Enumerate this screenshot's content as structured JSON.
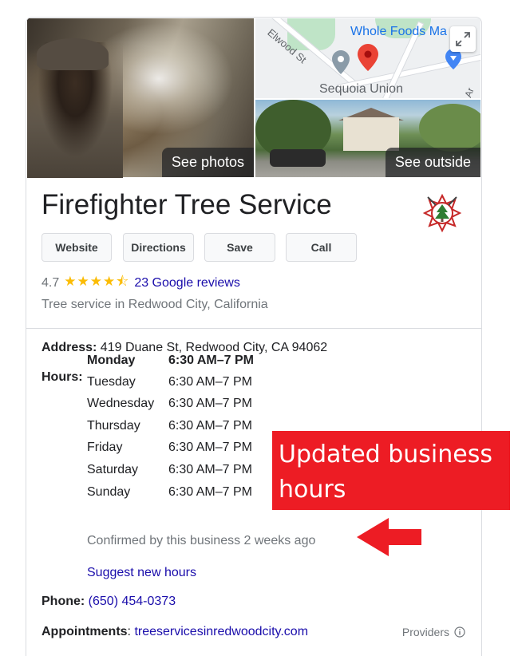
{
  "photos": {
    "main_button": "See photos",
    "outside_button": "See outside"
  },
  "map": {
    "place_label_1": "Whole Foods Ma",
    "place_label_2": "Sequoia Union",
    "street_label": "Elwood St",
    "street_label_2": "Ar"
  },
  "business": {
    "name": "Firefighter Tree Service",
    "category": "Tree service in Redwood City, California",
    "rating": "4.7",
    "stars": "★★★★⯪",
    "reviews_link": "23 Google reviews"
  },
  "actions": {
    "website": "Website",
    "directions": "Directions",
    "save": "Save",
    "call": "Call"
  },
  "address": {
    "label": "Address:",
    "value": " 419 Duane St, Redwood City, CA 94062"
  },
  "hours": {
    "label": "Hours:",
    "days": [
      {
        "day": "Monday",
        "time": "6:30 AM–7 PM"
      },
      {
        "day": "Tuesday",
        "time": "6:30 AM–7 PM"
      },
      {
        "day": "Wednesday",
        "time": "6:30 AM–7 PM"
      },
      {
        "day": "Thursday",
        "time": "6:30 AM–7 PM"
      },
      {
        "day": "Friday",
        "time": "6:30 AM–7 PM"
      },
      {
        "day": "Saturday",
        "time": "6:30 AM–7 PM"
      },
      {
        "day": "Sunday",
        "time": "6:30 AM–7 PM"
      }
    ],
    "confirmed": "Confirmed by this business 2 weeks ago",
    "suggest_link": "Suggest new hours"
  },
  "phone": {
    "label": "Phone:",
    "value": "(650) 454-0373"
  },
  "appointments": {
    "label": "Appointments",
    "separator": ":",
    "value": "treeservicesinredwoodcity.com",
    "providers": "Providers"
  },
  "annotation": {
    "line1": "Updated business",
    "line2": "hours"
  },
  "colors": {
    "link": "#1a0dab",
    "star": "#fbbc04",
    "annotation_red": "#ed1c24",
    "muted_text": "#70757a"
  }
}
